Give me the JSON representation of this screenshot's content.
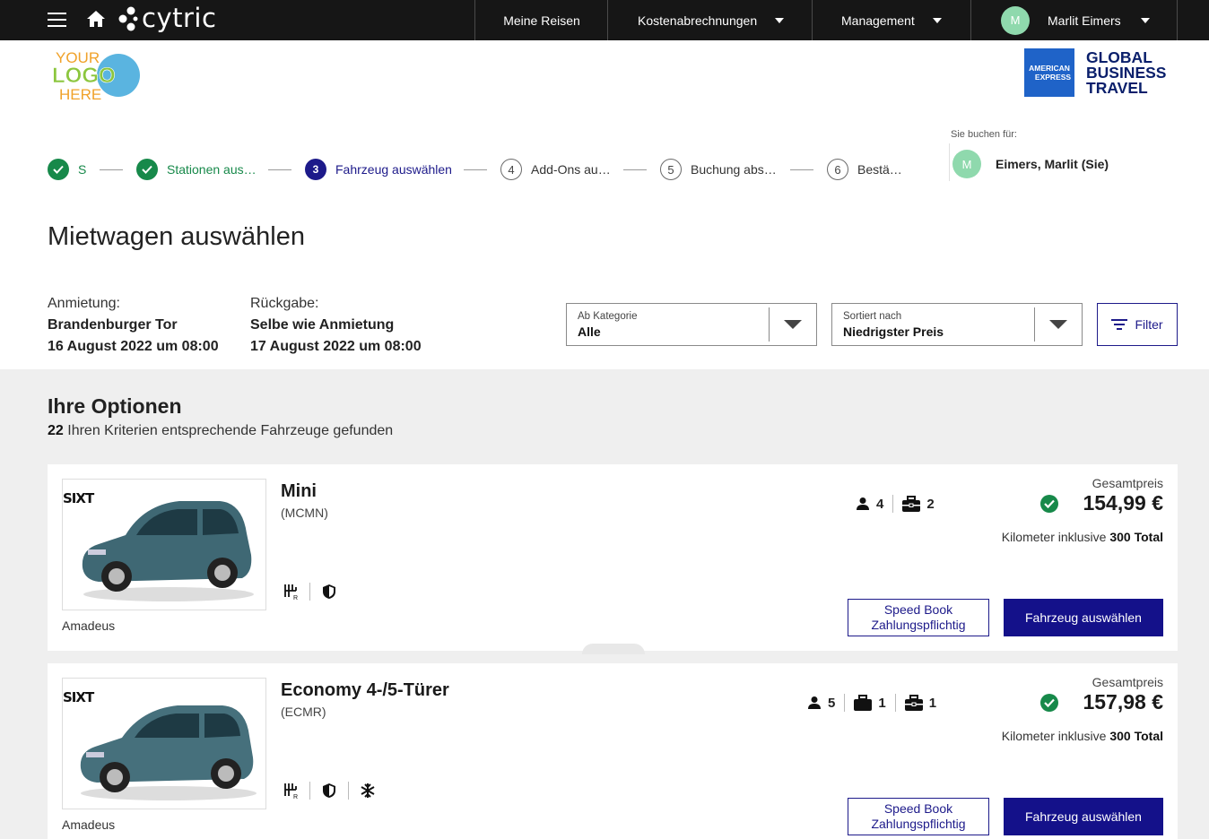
{
  "nav": {
    "brand": "cytric",
    "items": [
      {
        "label": "Meine Reisen"
      },
      {
        "label": "Kostenabrechnungen"
      },
      {
        "label": "Management"
      }
    ],
    "user": {
      "initial": "M",
      "name": "Marlit Eimers"
    }
  },
  "header": {
    "logo_lines": [
      "YOUR",
      "LOGO",
      "HERE"
    ],
    "amex_badge": [
      "AMERICAN",
      "EXPRESS"
    ],
    "amex_text": [
      "GLOBAL",
      "BUSINESS",
      "TRAVEL"
    ]
  },
  "stepper": [
    {
      "num": "1",
      "label": "S",
      "state": "done"
    },
    {
      "num": "2",
      "label": "Stationen aus…",
      "state": "done"
    },
    {
      "num": "3",
      "label": "Fahrzeug auswählen",
      "state": "active"
    },
    {
      "num": "4",
      "label": "Add-Ons au…",
      "state": "todo"
    },
    {
      "num": "5",
      "label": "Buchung abs…",
      "state": "todo"
    },
    {
      "num": "6",
      "label": "Bestä…",
      "state": "todo"
    }
  ],
  "booking_for": {
    "label": "Sie buchen für:",
    "initial": "M",
    "name": "Eimers, Marlit (Sie)"
  },
  "page_title": "Mietwagen auswählen",
  "pickup": {
    "label": "Anmietung:",
    "location": "Brandenburger Tor",
    "datetime": "16 August 2022 um 08:00"
  },
  "dropoff": {
    "label": "Rückgabe:",
    "location": "Selbe wie Anmietung",
    "datetime": "17 August 2022 um 08:00"
  },
  "category_select": {
    "label": "Ab Kategorie",
    "value": "Alle"
  },
  "sort_select": {
    "label": "Sortiert nach",
    "value": "Niedrigster Preis"
  },
  "filter_label": "Filter",
  "options": {
    "title": "Ihre Optionen",
    "count": "22",
    "count_text": " Ihren Kriterien entsprechende Fahrzeuge gefunden"
  },
  "results": [
    {
      "vendor_logo": "SIXT",
      "name": "Mini",
      "code": "(MCMN)",
      "provider": "Amadeus",
      "passengers": "4",
      "large_bags": null,
      "small_bags": "2",
      "features": [
        "manual-transmission-icon",
        "shield-icon"
      ],
      "total_label": "Gesamtpreis",
      "price": "154,99 €",
      "km_text": "Kilometer inklusive ",
      "km_value": "300 Total",
      "speedbook": [
        "Speed Book",
        "Zahlungspflichtig"
      ],
      "select_label": "Fahrzeug auswählen"
    },
    {
      "vendor_logo": "SIXT",
      "name": "Economy 4-/5-Türer",
      "code": "(ECMR)",
      "provider": "Amadeus",
      "passengers": "5",
      "large_bags": "1",
      "small_bags": "1",
      "features": [
        "manual-transmission-icon",
        "shield-icon",
        "snowflake-icon"
      ],
      "total_label": "Gesamtpreis",
      "price": "157,98 €",
      "km_text": "Kilometer inklusive ",
      "km_value": "300 Total",
      "speedbook": [
        "Speed Book",
        "Zahlungspflichtig"
      ],
      "select_label": "Fahrzeug auswählen"
    }
  ],
  "colors": {
    "primary": "#14118a",
    "success": "#17894a",
    "topbar": "#161616",
    "avatar": "#8fd9ad"
  }
}
